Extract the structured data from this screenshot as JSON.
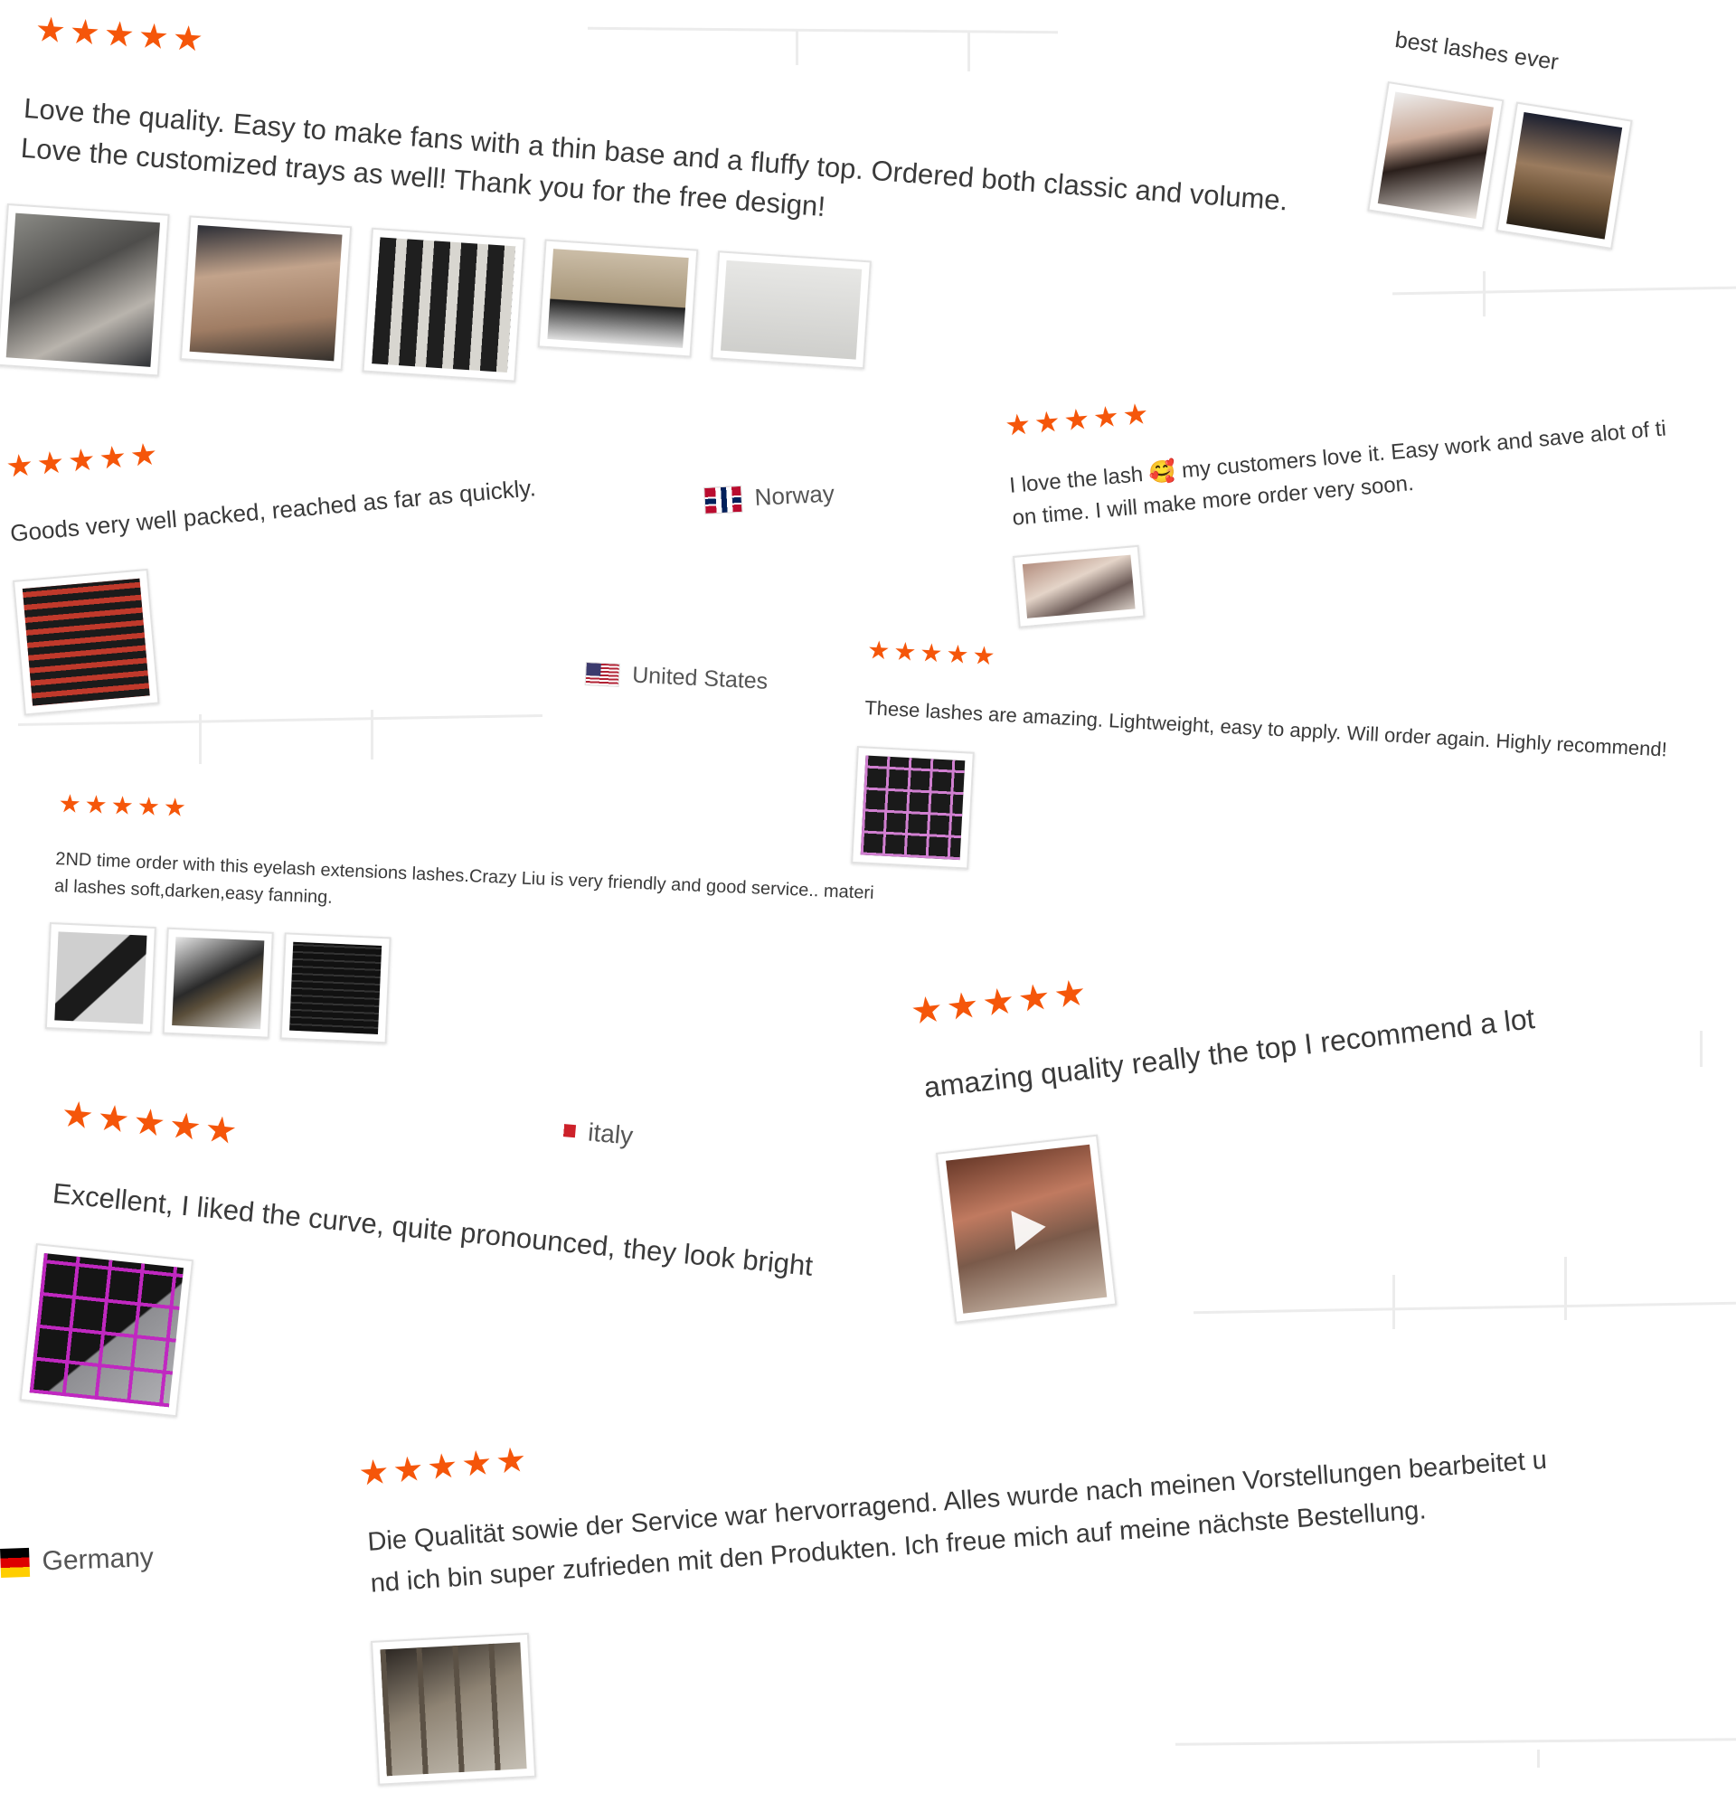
{
  "stars": "★★★★★",
  "reviews": {
    "r1": {
      "text_line1": "Love the quality. Easy to make fans with a thin base and a fluffy top. Ordered both classic and volume.",
      "text_line2": "Love the customized trays as well! Thank you for the free design!"
    },
    "r2": {
      "text": "best lashes ever"
    },
    "r3": {
      "text": "Goods very well packed, reached as far as quickly.",
      "country": "Norway"
    },
    "r4": {
      "text_line1_a": "I love the lash",
      "emoji": "🥰",
      "text_line1_b": "my customers love it. Easy work and save alot of ti",
      "text_line2": "on time. I will make more order very soon."
    },
    "r5": {
      "country": "United States"
    },
    "r6": {
      "text": "These lashes are amazing. Lightweight, easy to apply. Will order again. Highly recommend!"
    },
    "r7": {
      "text_line1": "2ND time order with this eyelash extensions lashes.Crazy Liu is very friendly and good service.. materi",
      "text_line2": "al lashes soft,darken,easy fanning."
    },
    "r8": {
      "text": "amazing quality really the top I recommend a lot"
    },
    "r9": {
      "country": "italy",
      "text": "Excellent, I liked the curve, quite pronounced, they look bright"
    },
    "r10": {
      "country": "Germany",
      "text_line1": "Die Qualität sowie der Service war hervorragend. Alles wurde nach meinen Vorstellungen bearbeitet u",
      "text_line2": "nd ich bin super zufrieden mit den Produkten. Ich freue mich auf meine nächste Bestellung."
    }
  },
  "colors": {
    "star": "#f5560a",
    "text": "#3a3a3a",
    "background": "#ffffff"
  }
}
